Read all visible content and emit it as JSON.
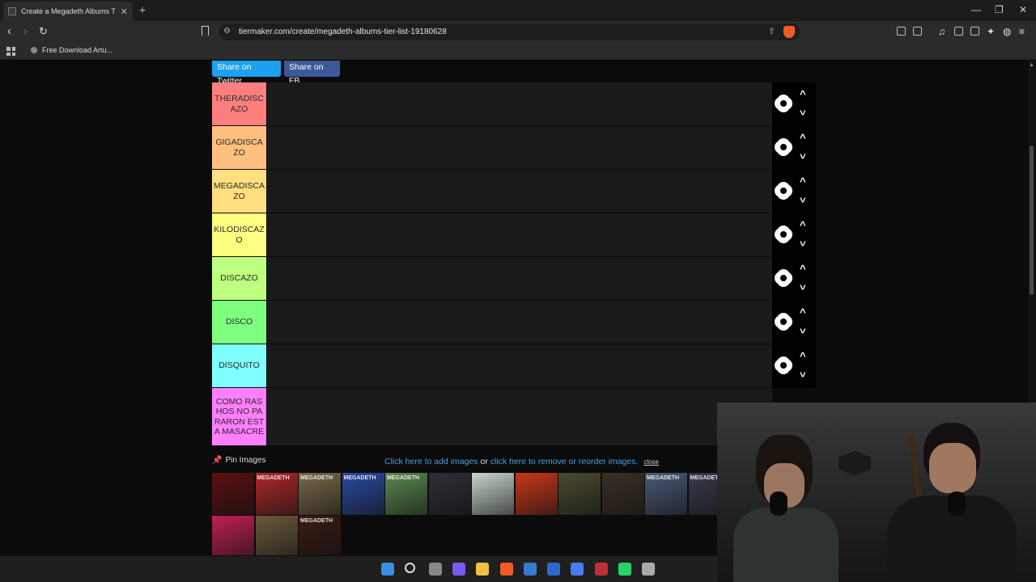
{
  "browser": {
    "tab_title": "Create a Megadeth Albums Tier",
    "tab_close": "✕",
    "new_tab": "+",
    "url": "tiermaker.com/create/megadeth-albums-tier-list-19180628",
    "bookmark": "Free Download Artu...",
    "window_controls": [
      "—",
      "❐",
      "✕"
    ]
  },
  "share": {
    "twitter_label": "Share on Twitter",
    "fb_label": "Share on FB"
  },
  "tiers": [
    {
      "label": "THERADISCAZO",
      "color": "#ff7f7f"
    },
    {
      "label": "GIGADISCAZO",
      "color": "#ffbf7f"
    },
    {
      "label": "MEGADISCAZO",
      "color": "#ffdf7f"
    },
    {
      "label": "KILODISCAZO",
      "color": "#ffff7f"
    },
    {
      "label": "DISCAZO",
      "color": "#bfff7f"
    },
    {
      "label": "DISCO",
      "color": "#7fff7f"
    },
    {
      "label": "DISQUITO",
      "color": "#7fffff"
    },
    {
      "label": "COMO RASHOS NO PARARON ESTA MASACRE",
      "color": "#ff7fff"
    }
  ],
  "pool": {
    "pin_label": "Pin Images",
    "add_text_1": "Click here to add images",
    "or_text": "or",
    "add_text_2": "click here to remove or reorder images.",
    "close_label": "close",
    "albums": [
      {
        "title": "",
        "color": "#5a1010"
      },
      {
        "title": "MEGADETH",
        "color": "#b0282a"
      },
      {
        "title": "MEGADETH",
        "color": "#7a6a4a"
      },
      {
        "title": "MEGADETH",
        "color": "#2a4aa0"
      },
      {
        "title": "MEGADETH",
        "color": "#5a8a50"
      },
      {
        "title": "",
        "color": "#2e2e36"
      },
      {
        "title": "",
        "color": "#c8d6cc"
      },
      {
        "title": "",
        "color": "#c83818"
      },
      {
        "title": "",
        "color": "#4a4a30"
      },
      {
        "title": "",
        "color": "#3a3024"
      },
      {
        "title": "MEGADETH",
        "color": "#4a5a78"
      },
      {
        "title": "MEGADETH",
        "color": "#3a3a4a"
      },
      {
        "title": "",
        "color": "#c02050"
      },
      {
        "title": "",
        "color": "#6a5a3a"
      },
      {
        "title": "MEGADETH",
        "color": "#3a1a12"
      }
    ]
  },
  "taskbar": {
    "icons": [
      "windows-icon",
      "search-icon",
      "taskview-icon",
      "copilot-icon",
      "folder-icon",
      "brave-icon",
      "store-icon",
      "outlook-icon",
      "edge-icon",
      "app-icon",
      "whatsapp-icon",
      "settings-icon"
    ]
  }
}
